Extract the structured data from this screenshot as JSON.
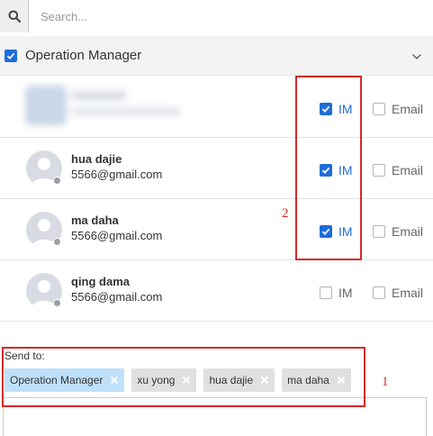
{
  "search": {
    "placeholder": "Search..."
  },
  "group": {
    "label": "Operation Manager",
    "checked": true
  },
  "rows": [
    {
      "name": "",
      "email": "",
      "im_label": "IM",
      "email_label": "Email",
      "im_checked": true,
      "email_checked": false,
      "blurred": true
    },
    {
      "name": "hua dajie",
      "email": "5566@gmail.com",
      "im_label": "IM",
      "email_label": "Email",
      "im_checked": true,
      "email_checked": false
    },
    {
      "name": "ma daha",
      "email": "5566@gmail.com",
      "im_label": "IM",
      "email_label": "Email",
      "im_checked": true,
      "email_checked": false
    },
    {
      "name": "qing dama",
      "email": "5566@gmail.com",
      "im_label": "IM",
      "email_label": "Email",
      "im_checked": false,
      "email_checked": false
    }
  ],
  "annotations": {
    "box1_number": "1",
    "box2_number": "2"
  },
  "send_to": {
    "label": "Send to:",
    "chips": [
      {
        "label": "Operation Manager",
        "primary": true
      },
      {
        "label": "xu yong",
        "primary": false
      },
      {
        "label": "hua dajie",
        "primary": false
      },
      {
        "label": "ma daha",
        "primary": false
      }
    ]
  },
  "colors": {
    "accent": "#1f6dd8",
    "annotation_red": "#d42a2a",
    "chip_primary": "#bfe0fb",
    "chip_secondary": "#e0e0e0"
  }
}
